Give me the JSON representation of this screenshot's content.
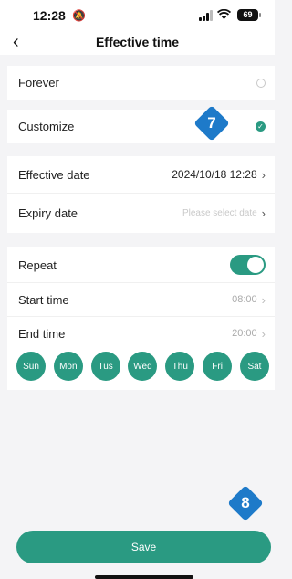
{
  "status_bar": {
    "time": "12:28",
    "battery": "69"
  },
  "nav": {
    "title": "Effective time"
  },
  "mode": {
    "forever_label": "Forever",
    "customize_label": "Customize",
    "selected": "Customize"
  },
  "dates": {
    "effective_label": "Effective date",
    "effective_value": "2024/10/18 12:28",
    "expiry_label": "Expiry date",
    "expiry_placeholder": "Please select date"
  },
  "repeat": {
    "label": "Repeat",
    "enabled": true,
    "start_label": "Start time",
    "start_value": "08:00",
    "end_label": "End time",
    "end_value": "20:00",
    "days": [
      "Sun",
      "Mon",
      "Tus",
      "Wed",
      "Thu",
      "Fri",
      "Sat"
    ]
  },
  "annotations": {
    "badge_1": "7",
    "badge_2": "8"
  },
  "save_label": "Save",
  "colors": {
    "accent": "#2a9a82",
    "badge": "#1e7ac9",
    "background": "#f4f4f6"
  },
  "icons": {
    "back": "chevron-left-icon",
    "bell": "bell-slash-icon",
    "chevron": "chevron-right-icon",
    "check": "checkmark-icon"
  }
}
